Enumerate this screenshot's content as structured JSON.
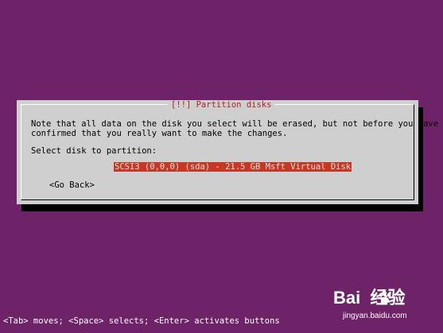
{
  "dialog": {
    "title": "[!!] Partition disks",
    "message_line1": "Note that all data on the disk you select will be erased, but not before you have",
    "message_line2": "confirmed that you really want to make the changes.",
    "select_label": "Select disk to partition:",
    "disks": [
      {
        "label": "SCSI3 (0,0,0) (sda) - 21.5 GB Msft Virtual Disk",
        "selected": true
      }
    ],
    "go_back_label": "<Go Back>"
  },
  "status_bar": {
    "text": "<Tab> moves; <Space> selects; <Enter> activates buttons"
  },
  "watermark": {
    "brand_text": "Bai  经验",
    "url": "jingyan.baidu.com"
  },
  "colors": {
    "background": "#6e2369",
    "dialog_background": "#cfcfcf",
    "dialog_title": "#b22222",
    "selected_option_bg": "#c73824",
    "selected_option_fg": "#f0e0e0"
  }
}
